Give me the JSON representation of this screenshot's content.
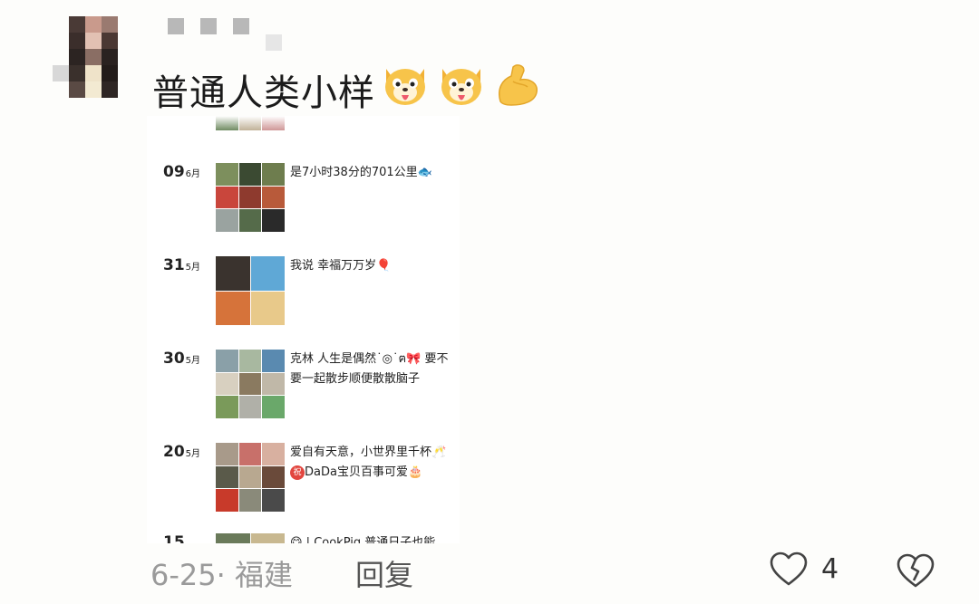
{
  "comment": {
    "text": "普通人类小样",
    "emojis": [
      "dog-face-tongue-icon",
      "dog-face-tongue-icon",
      "flexed-biceps-icon"
    ]
  },
  "embedded_screenshot": {
    "posts": [
      {
        "day": "09",
        "month": "6月",
        "text": "是7小时38分的701公里🐟"
      },
      {
        "day": "31",
        "month": "5月",
        "text": "我说 幸福万万岁🎈"
      },
      {
        "day": "30",
        "month": "5月",
        "text": "克林 人生是偶然˙◎˙ฅ🎀 要不要一起散步顺便散散脑子"
      },
      {
        "day": "20",
        "month": "5月",
        "text": "爱自有天意，小世界里千杯🥂",
        "text2": "DaDa宝贝百事可爱🎂",
        "badge": "祝"
      },
      {
        "day": "15",
        "month": "",
        "text": "😋 | CookPig 普通日子也能"
      }
    ]
  },
  "footer": {
    "meta": "6-25· 福建",
    "reply_label": "回复",
    "like_count": "4"
  },
  "colors": {
    "meta_gray": "#9a9a9a",
    "background": "#fdfdfb"
  }
}
